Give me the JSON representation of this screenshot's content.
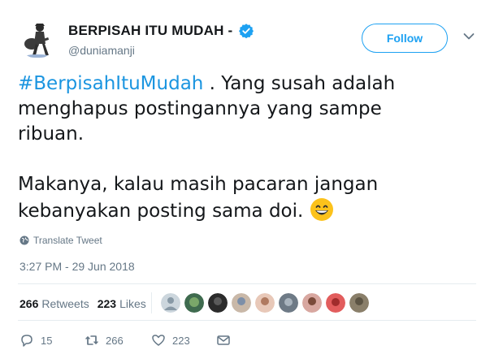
{
  "tweet": {
    "display_name": "BERPISAH ITU MUDAH -",
    "handle": "@duniamanji",
    "follow_label": "Follow",
    "text": {
      "hashtag": "#BerpisahItuMudah",
      "line1_rest": " . Yang susah adalah",
      "line2": "menghapus postingannya yang sampe",
      "line3": "ribuan.",
      "line4": "Makanya, kalau masih pacaran jangan",
      "line5": "kebanyakan posting sama doi."
    },
    "translate_label": "Translate Tweet",
    "timestamp": "3:27 PM - 29 Jun 2018",
    "stats": {
      "retweets_count": "266",
      "retweets_label": "Retweets",
      "likes_count": "223",
      "likes_label": "Likes"
    },
    "actions": {
      "replies": "15",
      "retweets": "266",
      "likes": "223"
    }
  },
  "colors": {
    "accent": "#1da1f2",
    "hashtag": "#1b95e0",
    "muted": "#657786",
    "text": "#14171a",
    "divider": "#e6ecf0"
  },
  "icons": [
    "avatar",
    "verified-badge-icon",
    "chevron-down-icon",
    "grinning-emoji-icon",
    "globe-icon",
    "reply-icon",
    "retweet-icon",
    "like-icon",
    "direct-message-icon"
  ]
}
